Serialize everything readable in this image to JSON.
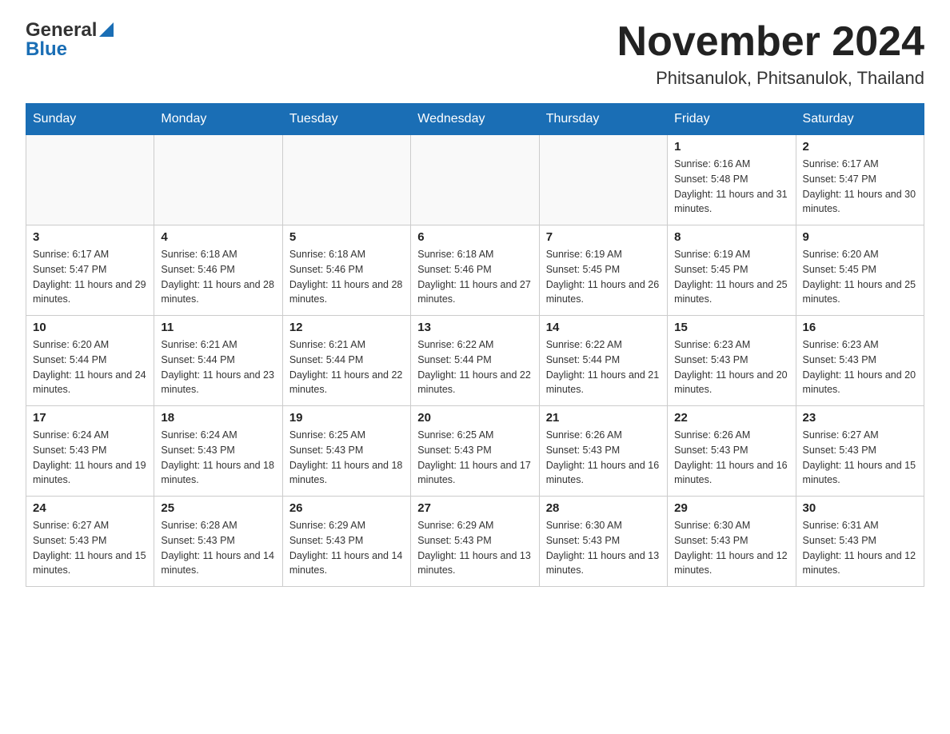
{
  "header": {
    "logo_name": "General",
    "logo_name2": "Blue",
    "month": "November 2024",
    "location": "Phitsanulok, Phitsanulok, Thailand"
  },
  "days_of_week": [
    "Sunday",
    "Monday",
    "Tuesday",
    "Wednesday",
    "Thursday",
    "Friday",
    "Saturday"
  ],
  "weeks": [
    [
      {
        "day": "",
        "info": ""
      },
      {
        "day": "",
        "info": ""
      },
      {
        "day": "",
        "info": ""
      },
      {
        "day": "",
        "info": ""
      },
      {
        "day": "",
        "info": ""
      },
      {
        "day": "1",
        "info": "Sunrise: 6:16 AM\nSunset: 5:48 PM\nDaylight: 11 hours and 31 minutes."
      },
      {
        "day": "2",
        "info": "Sunrise: 6:17 AM\nSunset: 5:47 PM\nDaylight: 11 hours and 30 minutes."
      }
    ],
    [
      {
        "day": "3",
        "info": "Sunrise: 6:17 AM\nSunset: 5:47 PM\nDaylight: 11 hours and 29 minutes."
      },
      {
        "day": "4",
        "info": "Sunrise: 6:18 AM\nSunset: 5:46 PM\nDaylight: 11 hours and 28 minutes."
      },
      {
        "day": "5",
        "info": "Sunrise: 6:18 AM\nSunset: 5:46 PM\nDaylight: 11 hours and 28 minutes."
      },
      {
        "day": "6",
        "info": "Sunrise: 6:18 AM\nSunset: 5:46 PM\nDaylight: 11 hours and 27 minutes."
      },
      {
        "day": "7",
        "info": "Sunrise: 6:19 AM\nSunset: 5:45 PM\nDaylight: 11 hours and 26 minutes."
      },
      {
        "day": "8",
        "info": "Sunrise: 6:19 AM\nSunset: 5:45 PM\nDaylight: 11 hours and 25 minutes."
      },
      {
        "day": "9",
        "info": "Sunrise: 6:20 AM\nSunset: 5:45 PM\nDaylight: 11 hours and 25 minutes."
      }
    ],
    [
      {
        "day": "10",
        "info": "Sunrise: 6:20 AM\nSunset: 5:44 PM\nDaylight: 11 hours and 24 minutes."
      },
      {
        "day": "11",
        "info": "Sunrise: 6:21 AM\nSunset: 5:44 PM\nDaylight: 11 hours and 23 minutes."
      },
      {
        "day": "12",
        "info": "Sunrise: 6:21 AM\nSunset: 5:44 PM\nDaylight: 11 hours and 22 minutes."
      },
      {
        "day": "13",
        "info": "Sunrise: 6:22 AM\nSunset: 5:44 PM\nDaylight: 11 hours and 22 minutes."
      },
      {
        "day": "14",
        "info": "Sunrise: 6:22 AM\nSunset: 5:44 PM\nDaylight: 11 hours and 21 minutes."
      },
      {
        "day": "15",
        "info": "Sunrise: 6:23 AM\nSunset: 5:43 PM\nDaylight: 11 hours and 20 minutes."
      },
      {
        "day": "16",
        "info": "Sunrise: 6:23 AM\nSunset: 5:43 PM\nDaylight: 11 hours and 20 minutes."
      }
    ],
    [
      {
        "day": "17",
        "info": "Sunrise: 6:24 AM\nSunset: 5:43 PM\nDaylight: 11 hours and 19 minutes."
      },
      {
        "day": "18",
        "info": "Sunrise: 6:24 AM\nSunset: 5:43 PM\nDaylight: 11 hours and 18 minutes."
      },
      {
        "day": "19",
        "info": "Sunrise: 6:25 AM\nSunset: 5:43 PM\nDaylight: 11 hours and 18 minutes."
      },
      {
        "day": "20",
        "info": "Sunrise: 6:25 AM\nSunset: 5:43 PM\nDaylight: 11 hours and 17 minutes."
      },
      {
        "day": "21",
        "info": "Sunrise: 6:26 AM\nSunset: 5:43 PM\nDaylight: 11 hours and 16 minutes."
      },
      {
        "day": "22",
        "info": "Sunrise: 6:26 AM\nSunset: 5:43 PM\nDaylight: 11 hours and 16 minutes."
      },
      {
        "day": "23",
        "info": "Sunrise: 6:27 AM\nSunset: 5:43 PM\nDaylight: 11 hours and 15 minutes."
      }
    ],
    [
      {
        "day": "24",
        "info": "Sunrise: 6:27 AM\nSunset: 5:43 PM\nDaylight: 11 hours and 15 minutes."
      },
      {
        "day": "25",
        "info": "Sunrise: 6:28 AM\nSunset: 5:43 PM\nDaylight: 11 hours and 14 minutes."
      },
      {
        "day": "26",
        "info": "Sunrise: 6:29 AM\nSunset: 5:43 PM\nDaylight: 11 hours and 14 minutes."
      },
      {
        "day": "27",
        "info": "Sunrise: 6:29 AM\nSunset: 5:43 PM\nDaylight: 11 hours and 13 minutes."
      },
      {
        "day": "28",
        "info": "Sunrise: 6:30 AM\nSunset: 5:43 PM\nDaylight: 11 hours and 13 minutes."
      },
      {
        "day": "29",
        "info": "Sunrise: 6:30 AM\nSunset: 5:43 PM\nDaylight: 11 hours and 12 minutes."
      },
      {
        "day": "30",
        "info": "Sunrise: 6:31 AM\nSunset: 5:43 PM\nDaylight: 11 hours and 12 minutes."
      }
    ]
  ]
}
